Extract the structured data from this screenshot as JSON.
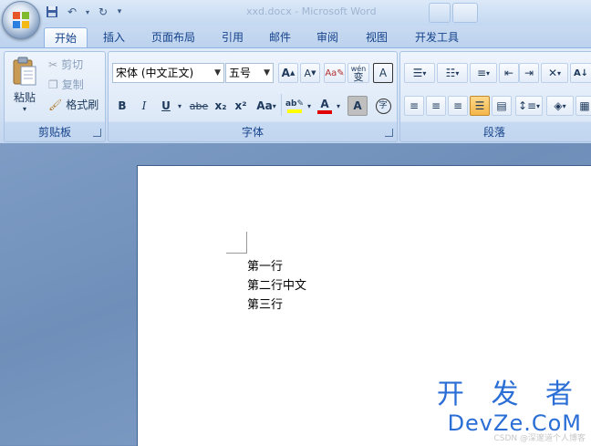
{
  "app": {
    "doc_title": "xxd.docx - Microsoft Word"
  },
  "tabs": [
    {
      "label": "开始",
      "active": true
    },
    {
      "label": "插入"
    },
    {
      "label": "页面布局"
    },
    {
      "label": "引用"
    },
    {
      "label": "邮件"
    },
    {
      "label": "审阅"
    },
    {
      "label": "视图"
    },
    {
      "label": "开发工具"
    }
  ],
  "clipboard": {
    "group_label": "剪贴板",
    "paste": "粘贴",
    "cut": "剪切",
    "copy": "复制",
    "format_painter": "格式刷"
  },
  "font": {
    "group_label": "字体",
    "font_name": "宋体 (中文正文)",
    "font_size": "五号",
    "grow": "A",
    "shrink": "A",
    "bold": "B",
    "italic": "I",
    "underline": "U",
    "strikethrough": "abe",
    "subscript": "x₂",
    "superscript": "x²",
    "change_case": "Aa",
    "font_color": "A",
    "char_shading": "A",
    "phonetic": "wén",
    "phonetic_char": "变",
    "char_border": "A",
    "enclose": "字",
    "highlight_color": "#ffff00",
    "font_color_value": "#e00000"
  },
  "paragraph": {
    "group_label": "段落"
  },
  "document": {
    "lines": [
      "第一行",
      "第二行中文",
      "第三行"
    ]
  },
  "watermark": {
    "cn": "开 发 者",
    "en": "DevZe.CoM",
    "credit": "CSDN @深邃道个人博客"
  }
}
